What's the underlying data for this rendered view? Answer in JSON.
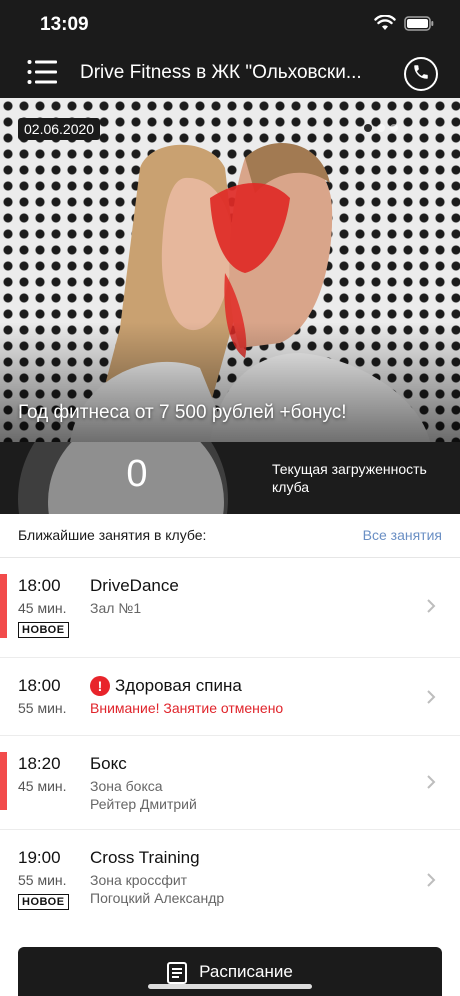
{
  "status_bar": {
    "time": "13:09",
    "wifi_icon": "wifi-icon",
    "battery_icon": "battery-icon"
  },
  "nav": {
    "title": "Drive Fitness в ЖК \"Ольховски...",
    "menu_icon": "menu-icon",
    "phone_icon": "phone-icon"
  },
  "banner": {
    "date": "02.06.2020",
    "caption": "Год фитнеса от 7 500 рублей +бонус!",
    "pager": {
      "count": 3,
      "active": 1
    }
  },
  "club_load": {
    "value": "0",
    "label": "Текущая загруженность клуба"
  },
  "classes_section": {
    "title": "Ближайшие занятия в клубе:",
    "all_link": "Все занятия"
  },
  "classes": [
    {
      "time": "18:00",
      "duration": "45 мин.",
      "name": "DriveDance",
      "sub1": "Зал №1",
      "sub2": "",
      "badge": "НОВОЕ",
      "marked": true,
      "cancelled": false,
      "warning": ""
    },
    {
      "time": "18:00",
      "duration": "55 мин.",
      "name": "Здоровая спина",
      "sub1": "",
      "sub2": "",
      "badge": "",
      "marked": false,
      "cancelled": true,
      "warning": "Внимание! Занятие отменено"
    },
    {
      "time": "18:20",
      "duration": "45 мин.",
      "name": "Бокс",
      "sub1": "Зона бокса",
      "sub2": "Рейтер Дмитрий",
      "badge": "",
      "marked": true,
      "cancelled": false,
      "warning": ""
    },
    {
      "time": "19:00",
      "duration": "55 мин.",
      "name": "Cross Training",
      "sub1": "Зона кроссфит",
      "sub2": "Погоцкий  Александр",
      "badge": "НОВОЕ",
      "marked": false,
      "cancelled": false,
      "warning": ""
    }
  ],
  "schedule_button": {
    "label": "Расписание",
    "icon": "schedule-icon"
  },
  "colors": {
    "dark": "#1b1b1b",
    "accent_red": "#f24b4b",
    "link_blue": "#6a8fc4",
    "warning_red": "#e0242b"
  }
}
